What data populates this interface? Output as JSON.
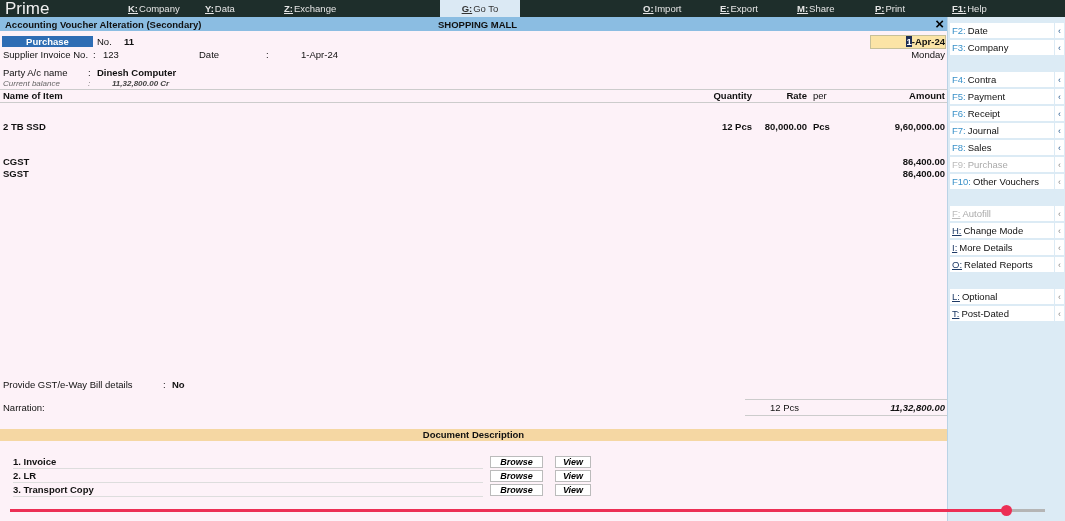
{
  "top_bar": {
    "app": "Prime",
    "menu": [
      {
        "key": "K:",
        "label": "Company",
        "selected": false
      },
      {
        "key": "Y:",
        "label": "Data",
        "selected": false
      },
      {
        "key": "Z:",
        "label": "Exchange",
        "selected": false
      },
      {
        "key": "G:",
        "label": "Go To",
        "selected": true
      },
      {
        "key": "O:",
        "label": "Import",
        "selected": false
      },
      {
        "key": "E:",
        "label": "Export",
        "selected": false
      },
      {
        "key": "M:",
        "label": "Share",
        "selected": false
      },
      {
        "key": "P:",
        "label": "Print",
        "selected": false
      },
      {
        "key": "F1:",
        "label": "Help",
        "selected": false
      }
    ]
  },
  "title_bar": {
    "title": "Accounting Voucher Alteration (Secondary)",
    "company": "SHOPPING MALL",
    "close": "×"
  },
  "voucher": {
    "type": "Purchase",
    "no_label": "No.",
    "no": "11",
    "date": "1-Apr-24",
    "day": "Monday",
    "supplier_invoice": {
      "label": "Supplier Invoice No.",
      "sep": ":",
      "value": "123"
    },
    "invoice_date": {
      "label": "Date",
      "sep": ":",
      "value": "1-Apr-24"
    },
    "party": {
      "label": "Party A/c name",
      "sep": ":",
      "value": "Dinesh  Computer"
    },
    "balance": {
      "label": "Current balance",
      "sep": ":",
      "value": "11,32,800.00 Cr"
    }
  },
  "table": {
    "columns": [
      "Name of Item",
      "Quantity",
      "Rate",
      "per",
      "Amount"
    ],
    "rows": [
      {
        "kind": "item",
        "name": "2 TB SSD",
        "quantity": "12 Pcs",
        "rate": "80,000.00",
        "per": "Pcs",
        "amount": "9,60,000.00"
      },
      {
        "kind": "tax",
        "name": "CGST",
        "amount": "86,400.00"
      },
      {
        "kind": "tax",
        "name": "SGST",
        "amount": "86,400.00"
      }
    ]
  },
  "gst_details": {
    "label": "Provide GST/e-Way Bill details",
    "sep": ":",
    "value": "No"
  },
  "narration": {
    "label": "Narration:",
    "total_quantity": "12 Pcs",
    "total_amount": "11,32,800.00"
  },
  "documents": {
    "title": "Document Description",
    "rows": [
      {
        "name": "1.  Invoice",
        "browse": "Browse",
        "view": "View"
      },
      {
        "name": "2.  LR",
        "browse": "Browse",
        "view": "View"
      },
      {
        "name": "3.  Transport Copy",
        "browse": "Browse",
        "view": "View"
      }
    ]
  },
  "sidebar": {
    "groups": [
      [
        {
          "key": "F2:",
          "label": "Date",
          "disabled": false,
          "arrow": "‹",
          "arrow_dim": false
        },
        {
          "key": "F3:",
          "label": "Company",
          "disabled": false,
          "arrow": "‹",
          "arrow_dim": false
        }
      ],
      [
        {
          "key": "F4:",
          "label": "Contra",
          "disabled": false,
          "arrow": "‹",
          "arrow_dim": false
        },
        {
          "key": "F5:",
          "label": "Payment",
          "disabled": false,
          "arrow": "‹",
          "arrow_dim": false
        },
        {
          "key": "F6:",
          "label": "Receipt",
          "disabled": false,
          "arrow": "‹",
          "arrow_dim": false
        },
        {
          "key": "F7:",
          "label": "Journal",
          "disabled": false,
          "arrow": "‹",
          "arrow_dim": false
        },
        {
          "key": "F8:",
          "label": "Sales",
          "disabled": false,
          "arrow": "‹",
          "arrow_dim": false
        },
        {
          "key": "F9:",
          "label": "Purchase",
          "disabled": true,
          "arrow": "‹",
          "arrow_dim": true
        },
        {
          "key": "F10:",
          "label": "Other Vouchers",
          "disabled": false,
          "arrow": "‹",
          "arrow_dim": true
        }
      ],
      [
        {
          "key": "F:",
          "label": "Autofill",
          "disabled": true,
          "arrow": "‹",
          "arrow_dim": true
        },
        {
          "key": "H:",
          "label": "Change Mode",
          "disabled": false,
          "arrow": "‹",
          "arrow_dim": true
        },
        {
          "key": "I:",
          "label": "More Details",
          "disabled": false,
          "arrow": "‹",
          "arrow_dim": true
        },
        {
          "key": "O:",
          "label": "Related Reports",
          "disabled": false,
          "arrow": "‹",
          "arrow_dim": true
        }
      ],
      [
        {
          "key": "L:",
          "label": "Optional",
          "disabled": false,
          "arrow": "‹",
          "arrow_dim": true
        },
        {
          "key": "T:",
          "label": "Post-Dated",
          "disabled": false,
          "arrow": "‹",
          "arrow_dim": true
        }
      ]
    ]
  },
  "video_progress": {
    "level": 0.962
  }
}
